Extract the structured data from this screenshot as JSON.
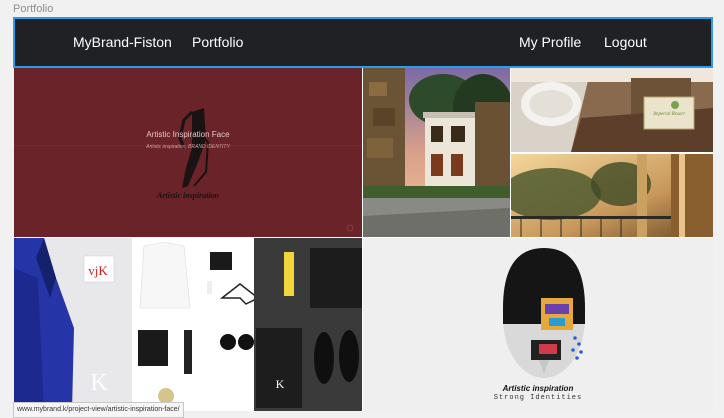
{
  "artboard": {
    "label": "Portfolio"
  },
  "nav": {
    "brand": "MyBrand-Fiston",
    "portfolio": "Portfolio",
    "profile": "My Profile",
    "logout": "Logout"
  },
  "tiles": {
    "artistic_face": {
      "title": "Artistic Inspiration Face",
      "subtitle": "Artistic inspiration, BRAND IDENTITY",
      "logo_text": "Artistic inspiration"
    },
    "resort_sign": "Imperial Resort",
    "brand_mark": "vjK",
    "strong_identities": {
      "line1": "Artistic inspiration",
      "line2": "Strong Identities"
    }
  },
  "status_url": "www.mybrand.k/project-view/artistic-inspiration-face/",
  "colors": {
    "nav_bg": "#1f2125",
    "nav_border": "#2e9bea",
    "maroon_tile": "#6a2328"
  }
}
